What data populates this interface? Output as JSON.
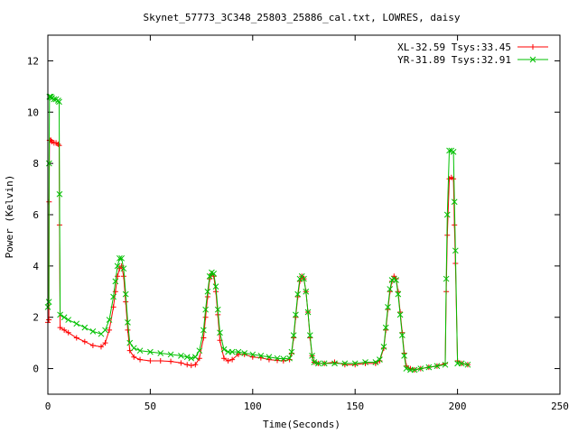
{
  "chart_data": {
    "type": "line",
    "title": "Skynet_57773_3C348_25803_25886_cal.txt, LOWRES, daisy",
    "xlabel": "Time(Seconds)",
    "ylabel": "Power (Kelvin)",
    "xlim": [
      0,
      250
    ],
    "ylim": [
      -1,
      13
    ],
    "xticks": [
      0,
      50,
      100,
      150,
      200,
      250
    ],
    "yticks": [
      0,
      2,
      4,
      6,
      8,
      10,
      12
    ],
    "grid": false,
    "legend_position": "top-right",
    "series": [
      {
        "name": "XL-32.59 Tsys:33.45",
        "color": "#ff0000",
        "marker": "+",
        "x": [
          0,
          0.5,
          0.6,
          0.8,
          1,
          1.5,
          2,
          3,
          4,
          5,
          5.5,
          5.7,
          6,
          8,
          10,
          14,
          18,
          22,
          26,
          28,
          30,
          32,
          33,
          34,
          35,
          36,
          37,
          38,
          39,
          40,
          42,
          45,
          50,
          55,
          60,
          65,
          68,
          70,
          72,
          74,
          76,
          77,
          78,
          79,
          80,
          81,
          82,
          83,
          84,
          86,
          88,
          90,
          93,
          96,
          100,
          104,
          108,
          112,
          115,
          118,
          119,
          120,
          121,
          122,
          123,
          124,
          125,
          126,
          127,
          128,
          129,
          130,
          132,
          135,
          140,
          145,
          150,
          155,
          160,
          162,
          164,
          165,
          166,
          167,
          168,
          169,
          170,
          171,
          172,
          173,
          174,
          175,
          177,
          179,
          182,
          186,
          190,
          194,
          194.5,
          195,
          196,
          197,
          198,
          198.5,
          199,
          200,
          202,
          205
        ],
        "y": [
          1.8,
          1.9,
          6.5,
          8.9,
          8.9,
          8.9,
          8.85,
          8.8,
          8.8,
          8.75,
          8.7,
          5.6,
          1.6,
          1.5,
          1.4,
          1.2,
          1.05,
          0.9,
          0.85,
          1.0,
          1.5,
          2.4,
          3.0,
          3.6,
          3.9,
          4.0,
          3.6,
          2.6,
          1.5,
          0.7,
          0.45,
          0.35,
          0.3,
          0.3,
          0.28,
          0.22,
          0.15,
          0.12,
          0.15,
          0.4,
          1.2,
          2.0,
          2.8,
          3.5,
          3.7,
          3.6,
          3.0,
          2.1,
          1.1,
          0.4,
          0.3,
          0.35,
          0.55,
          0.55,
          0.45,
          0.42,
          0.35,
          0.32,
          0.3,
          0.35,
          0.6,
          1.2,
          2.0,
          2.8,
          3.4,
          3.6,
          3.5,
          3.0,
          2.2,
          1.2,
          0.5,
          0.25,
          0.2,
          0.2,
          0.25,
          0.15,
          0.15,
          0.2,
          0.2,
          0.3,
          0.8,
          1.5,
          2.3,
          3.0,
          3.4,
          3.6,
          3.5,
          3.0,
          2.2,
          1.4,
          0.6,
          0.1,
          0.0,
          -0.05,
          0.0,
          0.05,
          0.1,
          0.2,
          3.0,
          5.2,
          7.4,
          7.45,
          7.4,
          5.6,
          4.1,
          0.3,
          0.2,
          0.15
        ]
      },
      {
        "name": "YR-31.89 Tsys:32.91",
        "color": "#00c000",
        "marker": "x",
        "x": [
          0,
          0.5,
          0.6,
          0.8,
          1,
          1.5,
          2,
          3,
          4,
          5,
          5.5,
          5.7,
          6,
          8,
          10,
          14,
          18,
          22,
          26,
          28,
          30,
          32,
          33,
          34,
          35,
          36,
          37,
          38,
          39,
          40,
          42,
          45,
          50,
          55,
          60,
          65,
          68,
          70,
          72,
          74,
          76,
          77,
          78,
          79,
          80,
          81,
          82,
          83,
          84,
          86,
          88,
          90,
          93,
          96,
          100,
          104,
          108,
          112,
          115,
          118,
          119,
          120,
          121,
          122,
          123,
          124,
          125,
          126,
          127,
          128,
          129,
          130,
          132,
          135,
          140,
          145,
          150,
          155,
          160,
          162,
          164,
          165,
          166,
          167,
          168,
          169,
          170,
          171,
          172,
          173,
          174,
          175,
          177,
          179,
          182,
          186,
          190,
          194,
          194.5,
          195,
          196,
          197,
          198,
          198.5,
          199,
          200,
          202,
          205
        ],
        "y": [
          2.4,
          2.6,
          8.0,
          10.6,
          10.6,
          10.6,
          10.55,
          10.5,
          10.5,
          10.45,
          10.4,
          6.8,
          2.1,
          2.0,
          1.9,
          1.75,
          1.6,
          1.45,
          1.35,
          1.5,
          1.9,
          2.8,
          3.4,
          4.0,
          4.3,
          4.3,
          3.9,
          2.9,
          1.8,
          1.0,
          0.8,
          0.7,
          0.65,
          0.6,
          0.55,
          0.5,
          0.45,
          0.4,
          0.45,
          0.7,
          1.5,
          2.3,
          3.0,
          3.6,
          3.75,
          3.7,
          3.2,
          2.3,
          1.4,
          0.75,
          0.65,
          0.65,
          0.65,
          0.6,
          0.55,
          0.5,
          0.45,
          0.4,
          0.38,
          0.4,
          0.65,
          1.3,
          2.1,
          2.9,
          3.5,
          3.6,
          3.5,
          3.0,
          2.2,
          1.3,
          0.5,
          0.25,
          0.2,
          0.2,
          0.2,
          0.2,
          0.2,
          0.25,
          0.25,
          0.35,
          0.85,
          1.6,
          2.4,
          3.1,
          3.45,
          3.5,
          3.45,
          2.9,
          2.1,
          1.3,
          0.5,
          0.0,
          -0.05,
          -0.05,
          0.0,
          0.05,
          0.1,
          0.15,
          3.5,
          6.0,
          8.5,
          8.5,
          8.45,
          6.5,
          4.6,
          0.2,
          0.2,
          0.15
        ]
      }
    ]
  }
}
